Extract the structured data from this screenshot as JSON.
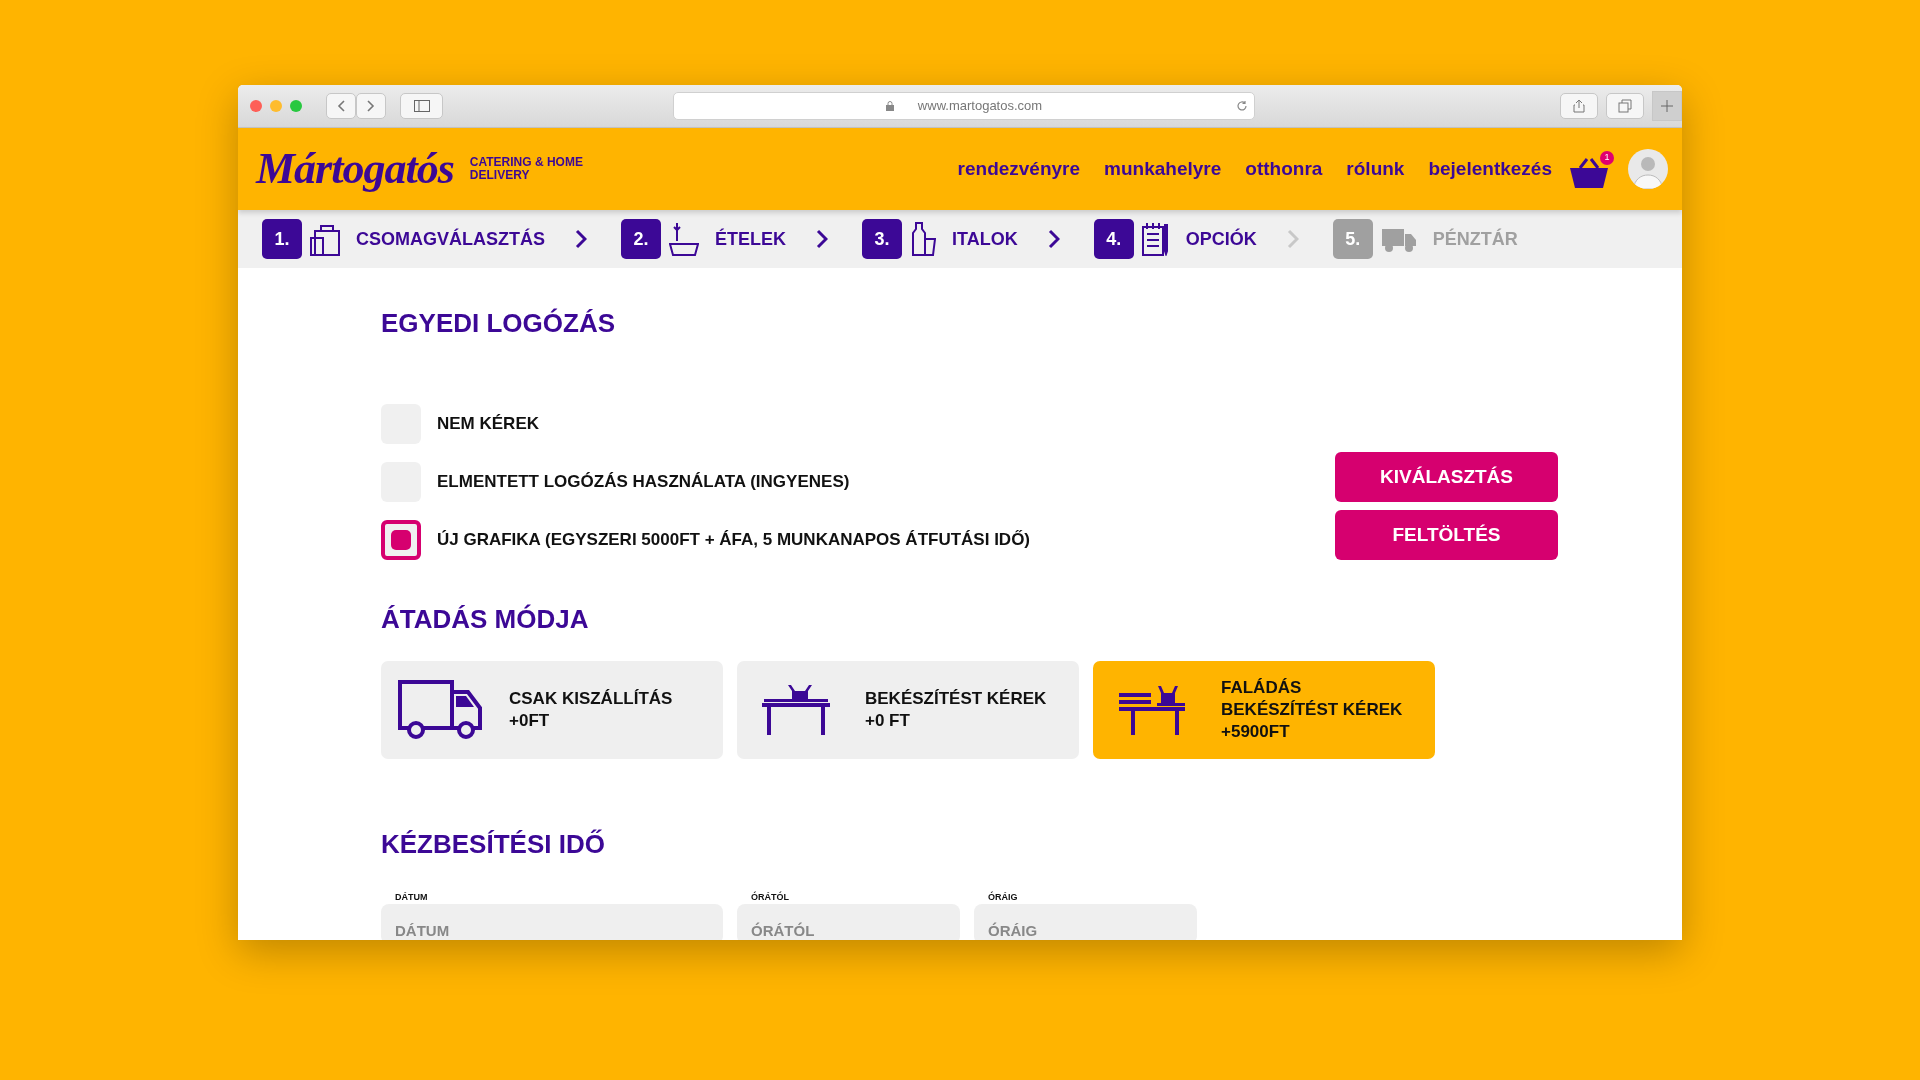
{
  "browser": {
    "url": "www.martogatos.com"
  },
  "header": {
    "logo": "Mártogatós",
    "tagline": "CATERING & HOME DELIVERY",
    "nav": [
      "rendezvényre",
      "munkahelyre",
      "otthonra",
      "rólunk",
      "bejelentkezés"
    ],
    "cart_count": "1"
  },
  "steps": [
    {
      "number": "1.",
      "label": "CSOMAGVÁLASZTÁS",
      "disabled": false
    },
    {
      "number": "2.",
      "label": "ÉTELEK",
      "disabled": false
    },
    {
      "number": "3.",
      "label": "ITALOK",
      "disabled": false
    },
    {
      "number": "4.",
      "label": "OPCIÓK",
      "disabled": false
    },
    {
      "number": "5.",
      "label": "PÉNZTÁR",
      "disabled": true
    }
  ],
  "logo_section": {
    "title": "EGYEDI LOGÓZÁS",
    "options": [
      {
        "label": "NEM KÉREK",
        "selected": false
      },
      {
        "label": "ELMENTETT LOGÓZÁS HASZNÁLATA (INGYENES)",
        "selected": false
      },
      {
        "label": "ÚJ GRAFIKA (EGYSZERI 5000FT + ÁFA, 5 MUNKANAPOS ÁTFUTÁSI IDŐ)",
        "selected": true
      }
    ],
    "buttons": [
      "KIVÁLASZTÁS",
      "FELTÖLTÉS"
    ]
  },
  "delivery": {
    "title": "ÁTADÁS MÓDJA",
    "options": [
      {
        "kind": "truck",
        "lines": [
          "CSAK KISZÁLLÍTÁS",
          "+0FT"
        ],
        "selected": false
      },
      {
        "kind": "table",
        "lines": [
          "BEKÉSZÍTÉST KÉREK",
          "+0 FT"
        ],
        "selected": false
      },
      {
        "kind": "bench",
        "lines": [
          "FALÁDÁS",
          "BEKÉSZÍTÉST KÉREK",
          "+5900FT"
        ],
        "selected": true
      }
    ]
  },
  "time": {
    "title": "KÉZBESÍTÉSI IDŐ",
    "fields": [
      {
        "label": "DÁTUM",
        "placeholder": "DÁTUM"
      },
      {
        "label": "ÓRÁTÓL",
        "placeholder": "ÓRÁTÓL"
      },
      {
        "label": "ÓRÁIG",
        "placeholder": "ÓRÁIG"
      }
    ]
  }
}
